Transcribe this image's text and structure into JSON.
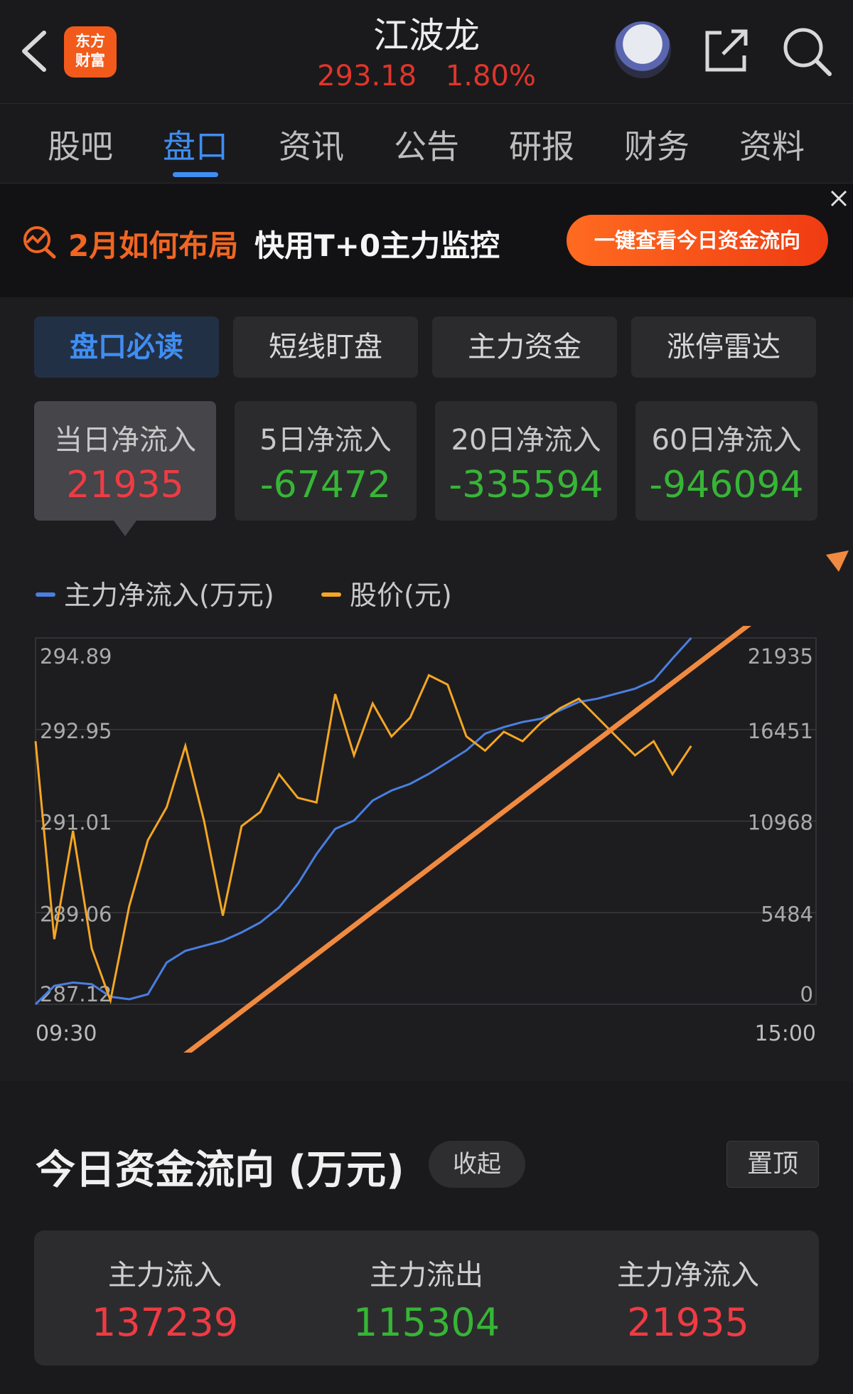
{
  "header": {
    "logo_line1": "东方",
    "logo_line2": "财富",
    "stock_name": "江波龙",
    "price": "293.18",
    "change": "1.80%"
  },
  "tabs": [
    "股吧",
    "盘口",
    "资讯",
    "公告",
    "研报",
    "财务",
    "资料"
  ],
  "active_tab": "盘口",
  "banner": {
    "title": "2月如何布局",
    "subtitle": "快用T+0主力监控",
    "button": "一键查看今日资金流向"
  },
  "subtabs": [
    "盘口必读",
    "短线盯盘",
    "主力资金",
    "涨停雷达"
  ],
  "net_inflow_cards": [
    {
      "label": "当日净流入",
      "value": "21935",
      "color": "#ef3b43"
    },
    {
      "label": "5日净流入",
      "value": "-67472",
      "color": "#37b536"
    },
    {
      "label": "20日净流入",
      "value": "-335594",
      "color": "#37b536"
    },
    {
      "label": "60日净流入",
      "value": "-946094",
      "color": "#37b536"
    }
  ],
  "legend": {
    "series1": "主力净流入(万元)",
    "series2": "股价(元)"
  },
  "colors": {
    "accent": "#3f8ef2",
    "up": "#ef3b43",
    "down": "#37b536",
    "price_line": "#f5a623",
    "inflow_line": "#4a7fe0",
    "annotation_arrow": "#f08a40"
  },
  "chart_data": {
    "type": "line",
    "x_start": "09:30",
    "x_end": "15:00",
    "left_axis_ticks": [
      "294.89",
      "292.95",
      "291.01",
      "289.06",
      "287.12"
    ],
    "right_axis_ticks": [
      "21935",
      "16451",
      "10968",
      "5484",
      "0"
    ],
    "series": [
      {
        "name": "主力净流入(万元)",
        "axis": "right",
        "values": [
          0,
          1100,
          1300,
          1200,
          450,
          300,
          600,
          2500,
          3200,
          3500,
          3800,
          4300,
          4900,
          5800,
          7200,
          9000,
          10500,
          11000,
          12200,
          12800,
          13200,
          13800,
          14500,
          15200,
          16200,
          16600,
          16900,
          17100,
          17600,
          18100,
          18300,
          18600,
          18900,
          19400,
          20700,
          21935
        ]
      },
      {
        "name": "股价(元)",
        "axis": "left",
        "values": [
          292.7,
          288.5,
          290.8,
          288.3,
          287.2,
          289.2,
          290.6,
          291.3,
          292.6,
          291.0,
          289.0,
          290.9,
          291.2,
          292.0,
          291.5,
          291.4,
          293.7,
          292.4,
          293.5,
          292.8,
          293.2,
          294.1,
          293.9,
          292.8,
          292.5,
          292.9,
          292.7,
          293.1,
          293.4,
          293.6,
          293.2,
          292.8,
          292.4,
          292.7,
          292.0,
          292.6
        ]
      }
    ]
  },
  "flow_section": {
    "title": "今日资金流向 (万元)",
    "collapse": "收起",
    "pin": "置顶",
    "items": [
      {
        "label": "主力流入",
        "value": "137239",
        "color": "#ef3b43"
      },
      {
        "label": "主力流出",
        "value": "115304",
        "color": "#37b536"
      },
      {
        "label": "主力净流入",
        "value": "21935",
        "color": "#ef3b43"
      }
    ]
  }
}
